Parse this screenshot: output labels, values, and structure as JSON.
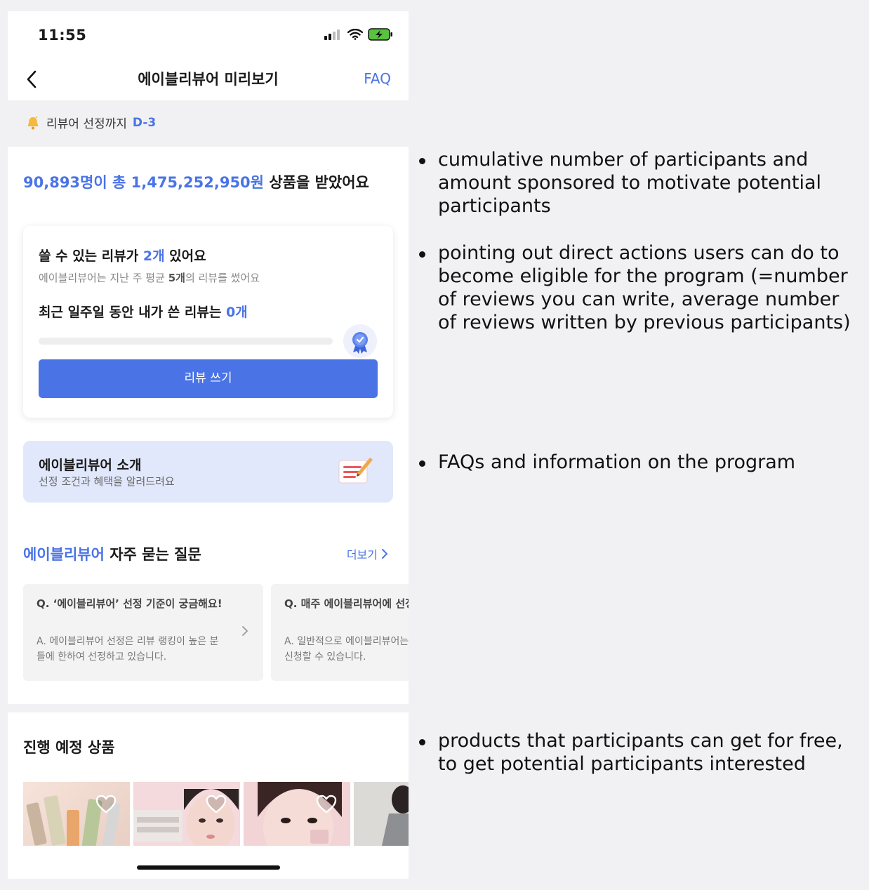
{
  "status_bar": {
    "time": "11:55"
  },
  "nav": {
    "title": "에이블리뷰어 미리보기",
    "faq": "FAQ"
  },
  "dday": {
    "label": "리뷰어 선정까지",
    "value": "D-3"
  },
  "headline": {
    "highlight": "90,893명이 총 1,475,252,950원",
    "rest": "상품을 받았어요"
  },
  "review_card": {
    "title_pre": "쓸 수 있는 리뷰가",
    "title_count": "2개",
    "title_post": "있어요",
    "subtitle_pre": "에이블리뷰어는 지난 주 평균",
    "subtitle_count": "5개",
    "subtitle_post": "의 리뷰를 썼어요",
    "recent_pre": "최근 일주일 동안 내가 쓴 리뷰는",
    "recent_count": "0개",
    "progress": 0,
    "write_button": "리뷰 쓰기"
  },
  "intro": {
    "title": "에이블리뷰어 소개",
    "subtitle": "선정 조건과 혜택을 알려드려요"
  },
  "faq_section": {
    "title_highlight": "에이블리뷰어",
    "title_rest": "자주 묻는 질문",
    "more": "더보기",
    "items": [
      {
        "q": "Q. ‘에이블리뷰어’ 선정 기준이 궁금해요!",
        "a": "A. 에이블리뷰어 선정은 리뷰 랭킹이 높은 분들에 한하여 선정하고 있습니다."
      },
      {
        "q": "Q. 매주 에이블리뷰어에 선정되면 요?",
        "a": "A. 일반적으로 에이블리뷰어는 한 번 쿠폰을 신청할 수 있습니다."
      }
    ]
  },
  "upcoming": {
    "title": "진행 예정 상품"
  },
  "annotations": [
    "cumulative number of participants and amount sponsored to motivate potential participants",
    "pointing out direct actions users can do to become eligible for the program (=number of reviews you can write, average number of reviews written by previous participants)",
    "FAQs and information on the program",
    "products that participants can get for free, to get potential participants interested"
  ],
  "colors": {
    "accent": "#4a74e6",
    "intro_bg": "#e1e8fb"
  },
  "icons": [
    "back-arrow-icon",
    "signal-icon",
    "wifi-icon",
    "battery-charging-icon",
    "bell-icon",
    "medal-icon",
    "memo-icon",
    "chevron-right-icon",
    "heart-icon"
  ]
}
